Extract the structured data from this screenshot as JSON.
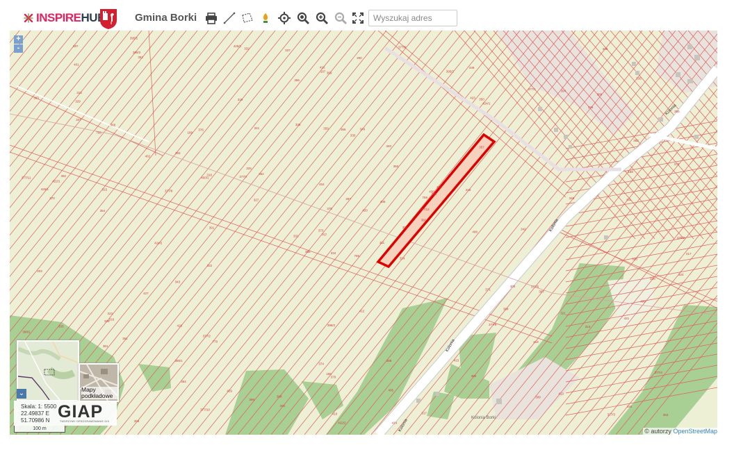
{
  "header": {
    "logo_part1": "INSPIRE",
    "logo_part2": "HUB",
    "municipality": "Gmina Borki",
    "toolbar": [
      {
        "icon": "printer-icon"
      },
      {
        "icon": "measure-distance-icon"
      },
      {
        "icon": "measure-area-icon"
      },
      {
        "icon": "location-pin-icon"
      },
      {
        "icon": "crosshair-icon"
      },
      {
        "icon": "zoom-search-icon"
      },
      {
        "icon": "zoom-in-icon"
      },
      {
        "icon": "zoom-out-icon"
      },
      {
        "icon": "fullscreen-icon"
      }
    ],
    "search_placeholder": "Wyszukaj adres"
  },
  "map": {
    "zoom_in": "+",
    "zoom_out": "-",
    "road_labels": [
      "Kolonia",
      "Kolonia",
      "Kolonia",
      "Kolonia"
    ],
    "place_label": "Kolonia Borki",
    "parcel_labels": [
      "765",
      "766",
      "767",
      "768",
      "769",
      "770",
      "348",
      "349",
      "350",
      "351",
      "352",
      "353",
      "354",
      "355",
      "356",
      "357",
      "358",
      "359",
      "360",
      "361",
      "362",
      "363",
      "364",
      "365",
      "366",
      "367",
      "368",
      "369",
      "370",
      "371",
      "372",
      "373",
      "374",
      "375",
      "376",
      "377/1",
      "377/2",
      "377/3",
      "377/4",
      "377/5",
      "377/6",
      "377/7",
      "377/8",
      "377/9",
      "377/10",
      "377/11",
      "377/12",
      "378",
      "379",
      "380",
      "381",
      "382",
      "383",
      "384",
      "385",
      "386/1",
      "386/2",
      "387",
      "388",
      "389",
      "390",
      "391",
      "392",
      "393",
      "394",
      "395/1",
      "395/2",
      "396",
      "397",
      "398/1",
      "398/2",
      "399",
      "400",
      "400/1",
      "400/2",
      "401",
      "402",
      "403",
      "404",
      "405",
      "406",
      "407",
      "408",
      "409",
      "410",
      "411",
      "412",
      "413",
      "414",
      "415",
      "416",
      "417",
      "418",
      "419",
      "420",
      "421",
      "422/1",
      "422/2",
      "423",
      "424/1",
      "424/2",
      "425/1",
      "425/2",
      "426/1",
      "427",
      "428",
      "429",
      "430",
      "326",
      "327",
      "328",
      "329",
      "330",
      "331",
      "332",
      "333",
      "334",
      "335",
      "336",
      "337",
      "338",
      "339",
      "340",
      "341",
      "342",
      "343",
      "344",
      "345",
      "346",
      "347",
      "316",
      "317",
      "318",
      "319",
      "320",
      "321",
      "322",
      "323",
      "324",
      "325",
      "314",
      "315",
      "310",
      "311",
      "312",
      "313",
      "308",
      "309",
      "186",
      "187",
      "188",
      "189"
    ],
    "colors": {
      "background": "#edf0d4",
      "parcel_line": "#e35d5d",
      "selected_outline": "#e00000",
      "selected_fill": "#f6d2bd",
      "forest": "#a8cf94",
      "road": "#ffffff"
    }
  },
  "overview": {
    "toggle_icon": "chevron-down-icon"
  },
  "basemaps": {
    "label": "Mapy podkładowe"
  },
  "info": {
    "scale": "Skala: 1: 5500",
    "lon": "22.49837 E",
    "lat": "51.70986 N",
    "brand": "GIAP",
    "brand_sub": "TWORZYMY OPROGRAMOWANIE GIS"
  },
  "scalebar": {
    "label": "100 m"
  },
  "attribution": {
    "prefix": "© autorzy",
    "link": "OpenStreetMap"
  }
}
